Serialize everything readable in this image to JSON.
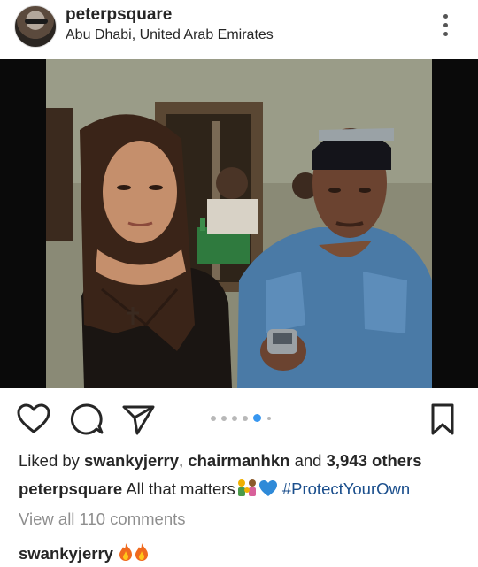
{
  "post": {
    "username": "peterpsquare",
    "location": "Abu Dhabi, United Arab Emirates"
  },
  "carousel": {
    "count": 6,
    "active_index": 4
  },
  "likes": {
    "prefix": "Liked by ",
    "user1": "swankyjerry",
    "sep": ", ",
    "user2": "chairmanhkn",
    "and": " and ",
    "others": "3,943 others"
  },
  "caption": {
    "username": "peterpsquare",
    "text": " All that matters",
    "hashtag": "#ProtectYourOwn"
  },
  "view_all": "View all 110 comments",
  "comment": {
    "username": "swankyjerry"
  },
  "icons": {
    "more": "more-vertical-icon",
    "like": "heart-icon",
    "comment": "comment-icon",
    "share": "send-icon",
    "save": "bookmark-icon"
  },
  "colors": {
    "link": "#1a4e8c",
    "muted": "#8e8e8e",
    "active_dot": "#3897f0"
  }
}
